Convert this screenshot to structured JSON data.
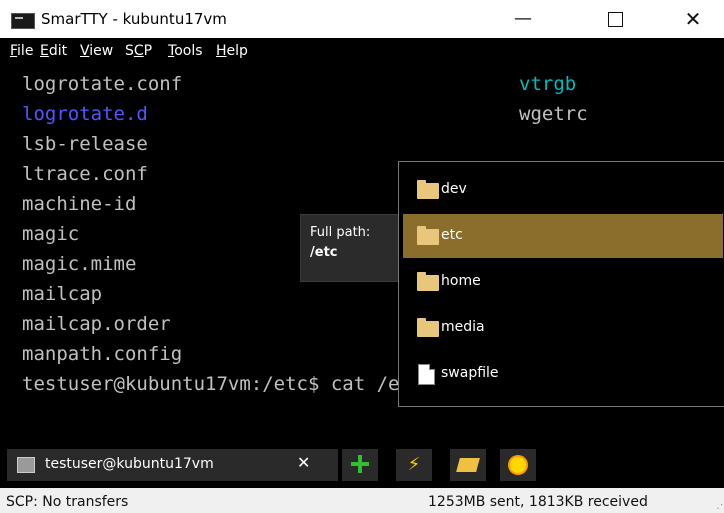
{
  "window": {
    "title": "SmarTTY - kubuntu17vm",
    "controls": {
      "minimize": "—",
      "close": "✕"
    }
  },
  "menu": [
    {
      "underline": "F",
      "rest": "ile"
    },
    {
      "underline": "E",
      "rest": "dit"
    },
    {
      "underline": "V",
      "rest": "iew"
    },
    {
      "prefix": "S",
      "underline": "C",
      "rest": "P"
    },
    {
      "underline": "T",
      "rest": "ools"
    },
    {
      "underline": "H",
      "rest": "elp"
    }
  ],
  "terminal": {
    "left_column": [
      "logrotate.conf",
      "logrotate.d",
      "lsb-release",
      "ltrace.conf",
      "machine-id",
      "magic",
      "magic.mime",
      "mailcap",
      "mailcap.order",
      "manpath.config"
    ],
    "right_column": [
      "vtrgb",
      "wgetrc"
    ],
    "prompt": "testuser@kubuntu17vm:/etc$ cat /e"
  },
  "tooltip": {
    "label": "Full path:",
    "value": "/etc"
  },
  "completion_popup": {
    "items": [
      {
        "label": "dev",
        "icon": "folder-icon"
      },
      {
        "label": "etc",
        "icon": "folder-icon",
        "selected": true
      },
      {
        "label": "home",
        "icon": "folder-icon"
      },
      {
        "label": "media",
        "icon": "folder-icon"
      },
      {
        "label": "swapfile",
        "icon": "file-icon"
      }
    ]
  },
  "tabs": {
    "active_tab": {
      "label": "testuser@kubuntu17vm",
      "close": "✕"
    },
    "toolbar_icons": [
      "new-session-icon",
      "quick-action-icon",
      "open-folder-icon",
      "settings-sun-icon"
    ]
  },
  "status": {
    "left": "SCP: No transfers",
    "right": "1253MB sent, 1813KB received"
  },
  "colors": {
    "selection": "#8b6d2c",
    "directory_text": "#5555ff",
    "cyan_text": "#00bcbc",
    "terminal_text": "#c0c0c0"
  }
}
